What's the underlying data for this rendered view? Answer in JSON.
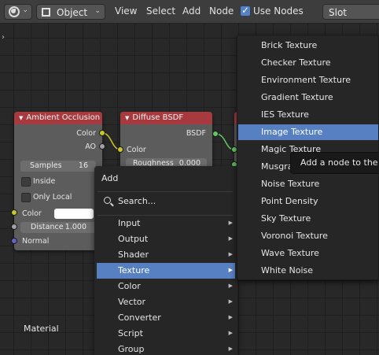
{
  "header": {
    "editor_type_icon": "node-editor-icon",
    "mode": "Object",
    "menus": [
      "View",
      "Select",
      "Add",
      "Node"
    ],
    "use_nodes_label": "Use Nodes",
    "use_nodes_checked": true,
    "slot_label": "Slot"
  },
  "nodes": {
    "ambient_occlusion": {
      "title": "Ambient Occlusion",
      "outputs": [
        "Color",
        "AO"
      ],
      "samples_label": "Samples",
      "samples_value": "16",
      "inside_label": "Inside",
      "only_local_label": "Only Local",
      "color_label": "Color",
      "distance_label": "Distance",
      "distance_value": "1.000",
      "normal_label": "Normal"
    },
    "diffuse_bsdf": {
      "title": "Diffuse BSDF",
      "output": "BSDF",
      "color_label": "Color",
      "roughness_label": "Roughness",
      "roughness_value": "0.000"
    }
  },
  "add_menu": {
    "title": "Add",
    "search_label": "Search...",
    "items": [
      {
        "label": "Input"
      },
      {
        "label": "Output"
      },
      {
        "label": "Shader"
      },
      {
        "label": "Texture"
      },
      {
        "label": "Color"
      },
      {
        "label": "Vector"
      },
      {
        "label": "Converter"
      },
      {
        "label": "Script"
      },
      {
        "label": "Group"
      }
    ],
    "active": "Texture"
  },
  "texture_menu": {
    "items": [
      {
        "label": "Brick Texture"
      },
      {
        "label": "Checker Texture"
      },
      {
        "label": "Environment Texture"
      },
      {
        "label": "Gradient Texture"
      },
      {
        "label": "IES Texture"
      },
      {
        "label": "Image Texture"
      },
      {
        "label": "Magic Texture"
      },
      {
        "label": "Musgrave Texture"
      },
      {
        "label": "Noise Texture"
      },
      {
        "label": "Point Density"
      },
      {
        "label": "Sky Texture"
      },
      {
        "label": "Voronoi Texture"
      },
      {
        "label": "Wave Texture"
      },
      {
        "label": "White Noise"
      }
    ],
    "active": "Image Texture"
  },
  "tooltip": "Add a node to the ac",
  "material_label": "Material",
  "colors": {
    "accent": "#5680c2",
    "node_header": "#a63a3f",
    "menu_bg": "#262626"
  }
}
